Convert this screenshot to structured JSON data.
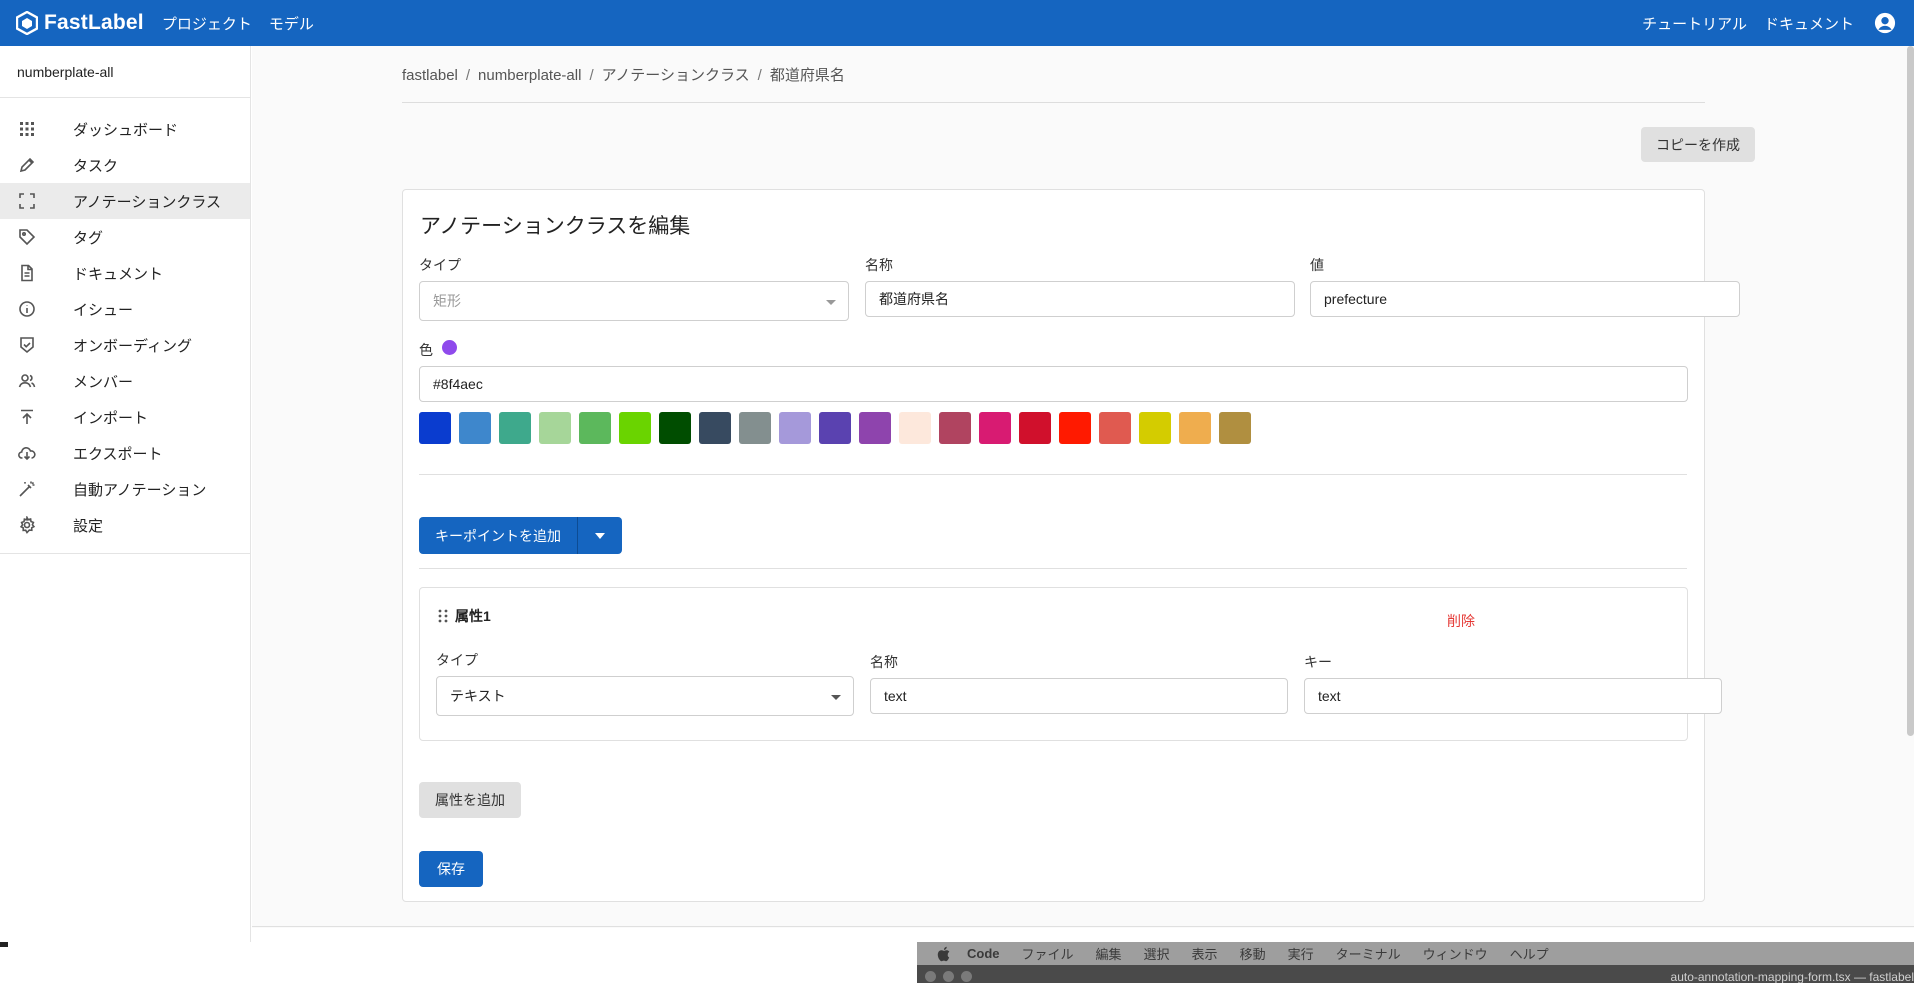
{
  "topbar": {
    "brand": "FastLabel",
    "nav": [
      "プロジェクト",
      "モデル"
    ],
    "right_links": [
      "チュートリアル",
      "ドキュメント"
    ]
  },
  "sidebar": {
    "project": "numberplate-all",
    "items": [
      {
        "label": "ダッシュボード",
        "icon": "grid-icon"
      },
      {
        "label": "タスク",
        "icon": "pencil-icon"
      },
      {
        "label": "アノテーションクラス",
        "icon": "bounding-box-icon",
        "active": true
      },
      {
        "label": "タグ",
        "icon": "tag-icon"
      },
      {
        "label": "ドキュメント",
        "icon": "document-icon"
      },
      {
        "label": "イシュー",
        "icon": "info-icon"
      },
      {
        "label": "オンボーディング",
        "icon": "shield-check-icon"
      },
      {
        "label": "メンバー",
        "icon": "members-icon"
      },
      {
        "label": "インポート",
        "icon": "upload-icon"
      },
      {
        "label": "エクスポート",
        "icon": "cloud-download-icon"
      },
      {
        "label": "自動アノテーション",
        "icon": "magic-wand-icon"
      },
      {
        "label": "設定",
        "icon": "gear-icon"
      }
    ]
  },
  "breadcrumb": [
    "fastlabel",
    "numberplate-all",
    "アノテーションクラス",
    "都道府県名"
  ],
  "copy_button": "コピーを作成",
  "form": {
    "title": "アノテーションクラスを編集",
    "type_label": "タイプ",
    "type_value": "矩形",
    "name_label": "名称",
    "name_value": "都道府県名",
    "value_label": "値",
    "value_value": "prefecture",
    "color_label": "色",
    "color_value": "#8f4aec",
    "selected_color": "#8f4aec",
    "swatches": [
      "#0a3ccf",
      "#3e87cc",
      "#3ea98c",
      "#a6d699",
      "#5cb85c",
      "#6ad400",
      "#004d00",
      "#374a60",
      "#838f8f",
      "#a599da",
      "#5a42b0",
      "#8e44ad",
      "#fde8dc",
      "#b04460",
      "#d81b72",
      "#d0102c",
      "#ff1a00",
      "#e05a50",
      "#d4cc00",
      "#efad4e",
      "#b08f40"
    ],
    "add_keypoint_button": "キーポイントを追加",
    "attribute": {
      "title": "属性1",
      "delete": "削除",
      "type_label": "タイプ",
      "type_value": "テキスト",
      "name_label": "名称",
      "name_value": "text",
      "key_label": "キー",
      "key_value": "text"
    },
    "add_attribute_button": "属性を追加",
    "save_button": "保存"
  },
  "mac_menubar": {
    "app": "Code",
    "items": [
      "ファイル",
      "編集",
      "選択",
      "表示",
      "移動",
      "実行",
      "ターミナル",
      "ウィンドウ",
      "ヘルプ"
    ],
    "window_title": "auto-annotation-mapping-form.tsx — fastlabel"
  }
}
